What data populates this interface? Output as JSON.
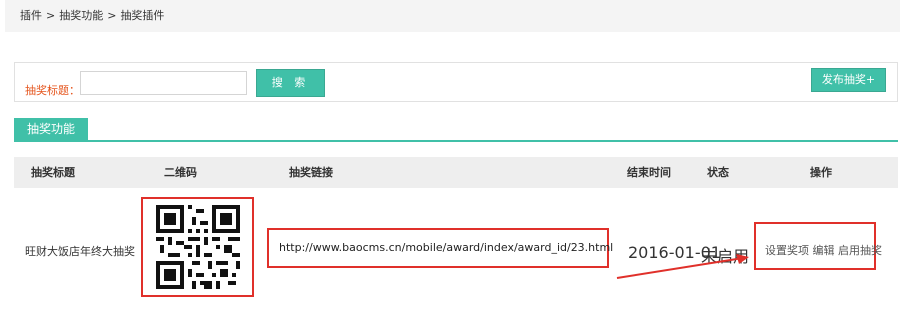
{
  "breadcrumb": {
    "items": [
      "插件",
      "抽奖功能",
      "抽奖插件"
    ],
    "separator": ">"
  },
  "search": {
    "label": "抽奖标题：",
    "placeholder": "",
    "value": "",
    "button_label": "搜 索"
  },
  "toolbar": {
    "publish_label": "发布抽奖+"
  },
  "section": {
    "title": "抽奖功能"
  },
  "table": {
    "columns": {
      "title": "抽奖标题",
      "qrcode": "二维码",
      "link": "抽奖链接",
      "end_time": "结束时间",
      "status": "状态",
      "ops": "操作"
    },
    "rows": [
      {
        "title": "旺财大饭店年终大抽奖",
        "link": "http://www.baocms.cn/mobile/award/index/award_id/23.html",
        "end_time": "2016-01-01",
        "status": "未启用",
        "ops": {
          "set_prizes": "设置奖项",
          "edit": "编辑",
          "enable": "启用抽奖"
        }
      }
    ]
  },
  "colors": {
    "accent": "#40c0a8",
    "highlight": "#e0302a",
    "label_orange": "#e5541c"
  }
}
